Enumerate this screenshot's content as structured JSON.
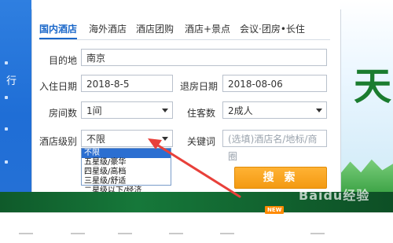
{
  "tabs": [
    {
      "label": "国内酒店",
      "active": true
    },
    {
      "label": "海外酒店",
      "active": false
    },
    {
      "label": "酒店团购",
      "active": false
    },
    {
      "label": "酒店+景点",
      "active": false
    },
    {
      "label": "会议·团房•长住",
      "active": false
    }
  ],
  "left_strip": {
    "text": "行"
  },
  "form": {
    "destination": {
      "label": "目的地",
      "value": "南京"
    },
    "checkin": {
      "label": "入住日期",
      "value": "2018-8-5"
    },
    "checkout": {
      "label": "退房日期",
      "value": "2018-08-06"
    },
    "rooms": {
      "label": "房间数",
      "value": "1间"
    },
    "guests": {
      "label": "住客数",
      "value": "2成人"
    },
    "star": {
      "label": "酒店级别",
      "value": "不限"
    },
    "keyword": {
      "label": "关键词",
      "placeholder": "(选填)酒店名/地标/商圈"
    }
  },
  "star_options": [
    "不限",
    "五星级/豪华",
    "四星级/高档",
    "三星级/舒适",
    "二星级以下/经济"
  ],
  "search_label": "搜 索",
  "banner": {
    "char": "天"
  },
  "badge": "NEW",
  "watermark": "Baidu经验",
  "colors": {
    "accent_blue": "#1a67c9",
    "search_orange": "#f39a12",
    "arrow_red": "#e8403a",
    "selected_blue": "#2c6fd1"
  }
}
